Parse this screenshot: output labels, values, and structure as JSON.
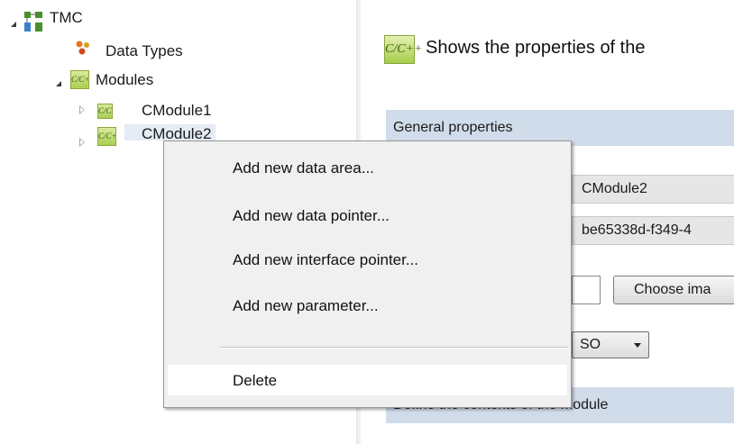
{
  "tree": {
    "root": {
      "label": "TMC",
      "icon": "solution-tree-icon"
    },
    "items": [
      {
        "label": "Data Types",
        "icon": "data-types-icon"
      },
      {
        "label": "Modules",
        "icon": "modules-folder-icon",
        "icon_text": "C/C++"
      },
      {
        "label": "CModule1",
        "icon": "cpp-module-icon",
        "icon_text": "C/C++"
      },
      {
        "label": "CModule2",
        "icon": "cpp-module-icon",
        "icon_text": "C/C++"
      }
    ]
  },
  "properties": {
    "header_icon_text": "C/C++",
    "header_text": "Shows the properties of the",
    "general_section": "General properties",
    "name_value": "CModule2",
    "guid_value": "be65338d-f349-4",
    "choose_image_label": "Choose ima",
    "dropdown_value": "SO",
    "context_section": "Define the contexts of the module"
  },
  "context_menu": {
    "items": [
      "Add new data area...",
      "Add new data pointer...",
      "Add new interface pointer...",
      "Add new parameter...",
      "Delete"
    ],
    "highlighted": "Delete"
  },
  "colors": {
    "section_band": "#d1dcea",
    "module_icon_green": "#a9cf52",
    "menu_background": "#f0f0f0"
  }
}
